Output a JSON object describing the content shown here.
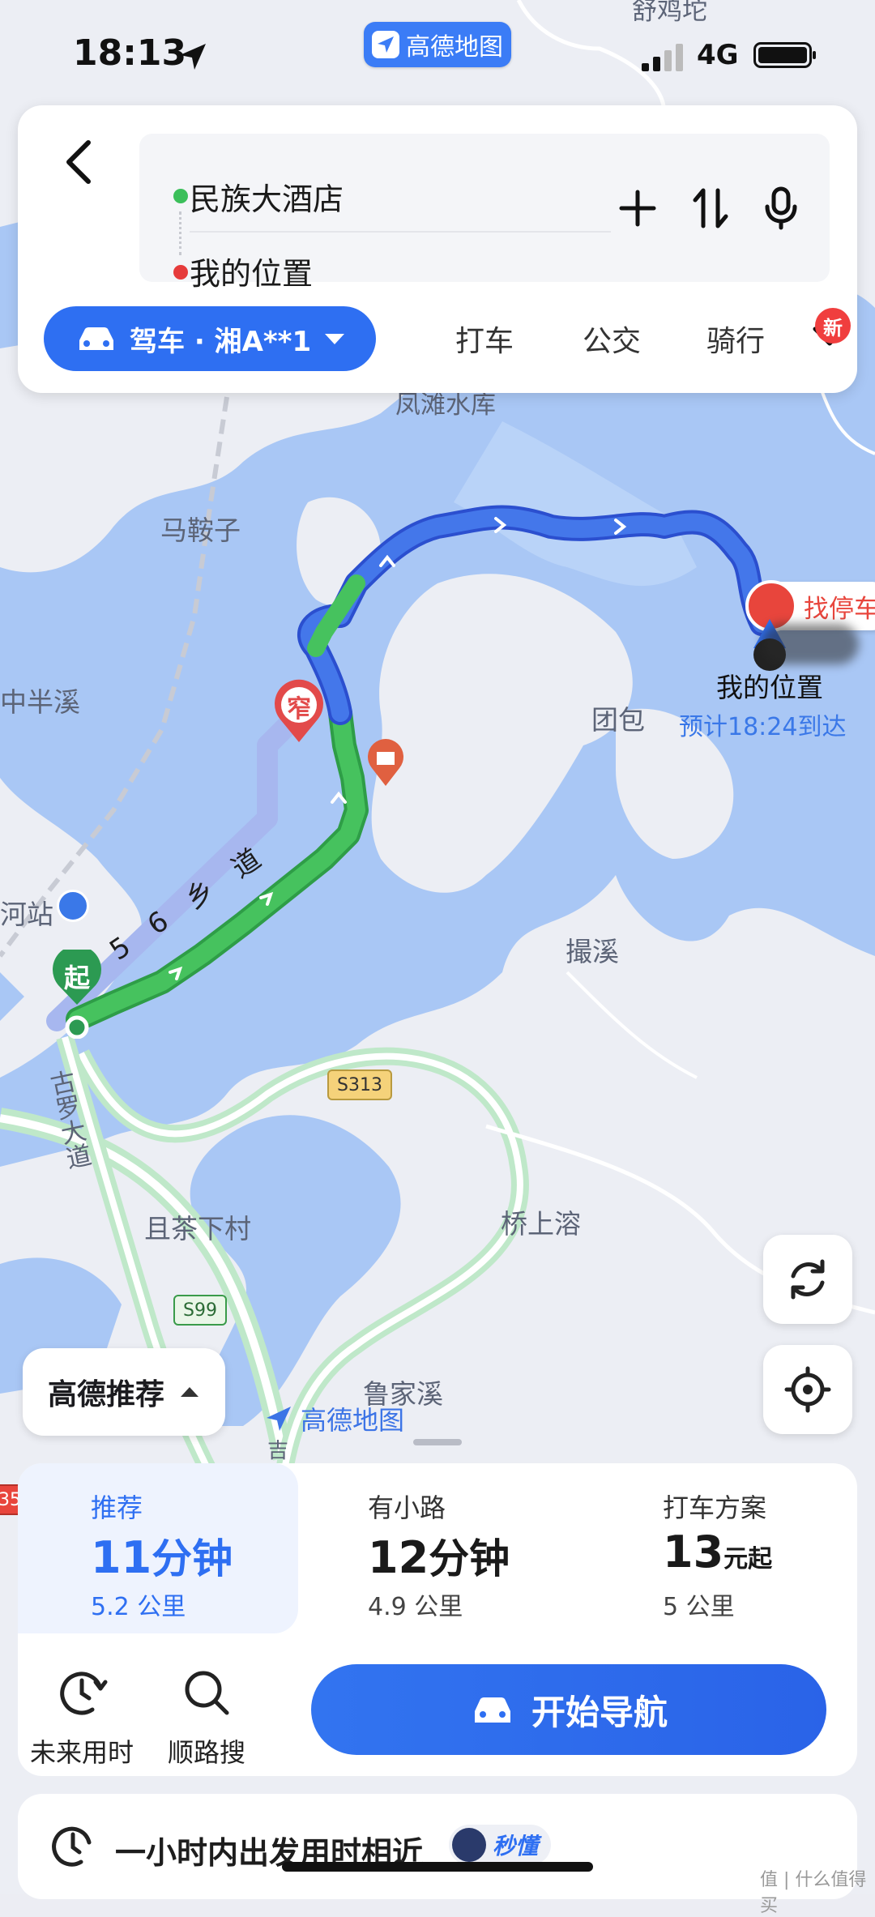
{
  "status_bar": {
    "time": "18:13",
    "app_badge": "高德地图",
    "network": "4G"
  },
  "search": {
    "origin": "民族大酒店",
    "destination": "我的位置"
  },
  "modes": {
    "selected_label": "驾车 · 湘A**1",
    "tabs": [
      "打车",
      "公交",
      "骑行"
    ],
    "new_badge": "新"
  },
  "map": {
    "labels": {
      "reservoir": "凤滩水库",
      "place_top": "舒鸡坨",
      "maanzi": "马鞍子",
      "zhongbanxi": "中半溪",
      "tuanbao": "团包",
      "niexi": "撮溪",
      "station": "河站",
      "qiechaxia": "且茶下村",
      "qiaoshangrong": "桥上溶",
      "lujiaxi": "鲁家溪",
      "guluo": "古罗大道",
      "gu_small": "吉"
    },
    "narrow_sign": "窄",
    "my_location": "我的位置",
    "eta": "预计18:24到达",
    "parking": "找停车",
    "start_marker": "起",
    "route_road_label": "6 乡 道",
    "route_road_prefix": "5",
    "road_badges": [
      "S313",
      "S99",
      "35"
    ],
    "watermark": "高德地图"
  },
  "recommend_pill": "高德推荐",
  "routes": [
    {
      "label": "推荐",
      "value": "11",
      "unit": "分钟",
      "distance": "5.2 公里"
    },
    {
      "label": "有小路",
      "value": "12",
      "unit": "分钟",
      "distance": "4.9 公里"
    },
    {
      "label": "打车方案",
      "value": "13",
      "unit": "元起",
      "distance": "5 公里"
    }
  ],
  "actions": {
    "future": "未来用时",
    "along_search": "顺路搜",
    "start_nav": "开始导航"
  },
  "bottom_tip": {
    "text": "一小时内出发用时相近",
    "tag": "秒懂"
  },
  "corner_mark": "值 | 什么值得买"
}
